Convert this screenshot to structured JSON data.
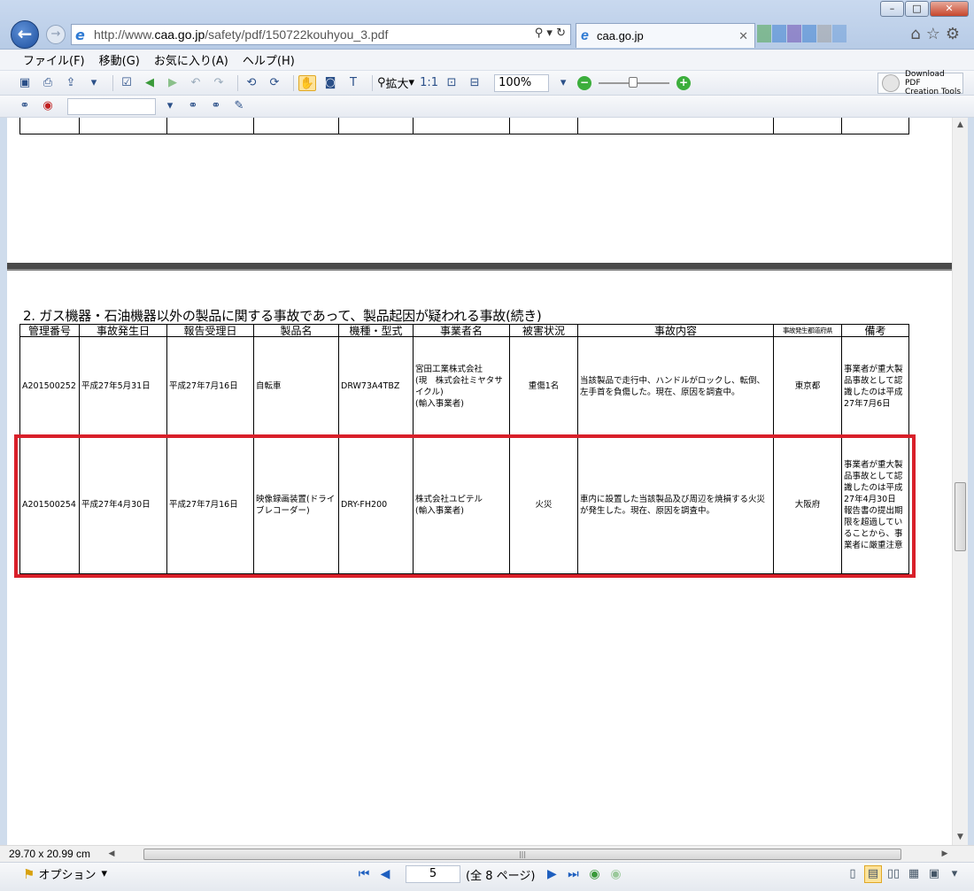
{
  "browser": {
    "url_prefix": "http://www.",
    "url_domain": "caa.go.jp",
    "url_path": "/safety/pdf/150722kouhyou_3.pdf",
    "tab_title": "caa.go.jp",
    "window_controls": {
      "minimize": "–",
      "maximize": "□",
      "close": "✕"
    }
  },
  "menu": [
    "ファイル(F)",
    "移動(G)",
    "お気に入り(A)",
    "ヘルプ(H)"
  ],
  "toolbar": {
    "zoom_in_label": "拡大",
    "zoom_value": "100%",
    "download_line1": "Download PDF",
    "download_line2": "Creation Tools"
  },
  "document": {
    "section_title": "2. ガス機器・石油機器以外の製品に関する事故であって、製品起因が疑われる事故(続き)",
    "columns": [
      "管理番号",
      "事故発生日",
      "報告受理日",
      "製品名",
      "機種・型式",
      "事業者名",
      "被害状況",
      "事故内容",
      "事故発生都道府県",
      "備考"
    ],
    "rows": [
      {
        "id": "A201500252",
        "accident_date": "平成27年5月31日",
        "report_date": "平成27年7月16日",
        "product": "自転車",
        "model": "DRW73A4TBZ",
        "company": "宮田工業株式会社\n(現　株式会社ミヤタサイクル)\n(輸入事業者)",
        "damage": "重傷1名",
        "content": "当該製品で走行中、ハンドルがロックし、転倒、左手首を負傷した。現在、原因を調査中。",
        "prefecture": "東京都",
        "remarks": "事業者が重大製品事故として認識したのは平成27年7月6日"
      },
      {
        "id": "A201500254",
        "accident_date": "平成27年4月30日",
        "report_date": "平成27年7月16日",
        "product": "映像録画装置(ドライブレコーダー)",
        "model": "DRY-FH200",
        "company": "株式会社ユピテル\n(輸入事業者)",
        "damage": "火災",
        "content": "車内に設置した当該製品及び周辺を焼損する火災が発生した。現在、原因を調査中。",
        "prefecture": "大阪府",
        "remarks": "事業者が重大製品事故として認識したのは平成27年4月30日\n報告書の提出期限を超過していることから、事業者に厳重注意"
      }
    ]
  },
  "status": {
    "page_size": "29.70 x 20.99 cm",
    "options_label": "オプション",
    "current_page": "5",
    "page_total": "(全 8 ページ)"
  },
  "colors": {
    "highlight": "#d9202a",
    "accent": "#1d4f9e"
  }
}
